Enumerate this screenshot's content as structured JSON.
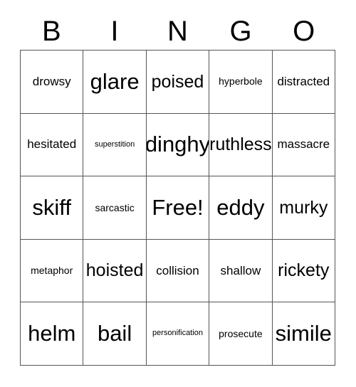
{
  "card": {
    "title": "BINGO",
    "header_letters": [
      "B",
      "I",
      "N",
      "G",
      "O"
    ],
    "free_space_label": "Free!",
    "colors": {
      "background": "#ffffff",
      "text": "#000000",
      "grid_line": "#555555"
    },
    "grid_size": "5x5",
    "rows": [
      [
        {
          "text": "drowsy",
          "size": "md"
        },
        {
          "text": "glare",
          "size": "xxl"
        },
        {
          "text": "poised",
          "size": "xl"
        },
        {
          "text": "hyperbole",
          "size": "sm"
        },
        {
          "text": "distracted",
          "size": "md"
        }
      ],
      [
        {
          "text": "hesitated",
          "size": "md"
        },
        {
          "text": "superstition",
          "size": "xs"
        },
        {
          "text": "dinghy",
          "size": "xxl"
        },
        {
          "text": "ruthless",
          "size": "xl"
        },
        {
          "text": "massacre",
          "size": "md"
        }
      ],
      [
        {
          "text": "skiff",
          "size": "xxl"
        },
        {
          "text": "sarcastic",
          "size": "sm"
        },
        {
          "text": "Free!",
          "size": "xxl"
        },
        {
          "text": "eddy",
          "size": "xxl"
        },
        {
          "text": "murky",
          "size": "xl"
        }
      ],
      [
        {
          "text": "metaphor",
          "size": "sm"
        },
        {
          "text": "hoisted",
          "size": "xl"
        },
        {
          "text": "collision",
          "size": "md"
        },
        {
          "text": "shallow",
          "size": "md"
        },
        {
          "text": "rickety",
          "size": "xl"
        }
      ],
      [
        {
          "text": "helm",
          "size": "xxl"
        },
        {
          "text": "bail",
          "size": "xxl"
        },
        {
          "text": "personification",
          "size": "xs"
        },
        {
          "text": "prosecute",
          "size": "sm"
        },
        {
          "text": "simile",
          "size": "xxl"
        }
      ]
    ]
  }
}
